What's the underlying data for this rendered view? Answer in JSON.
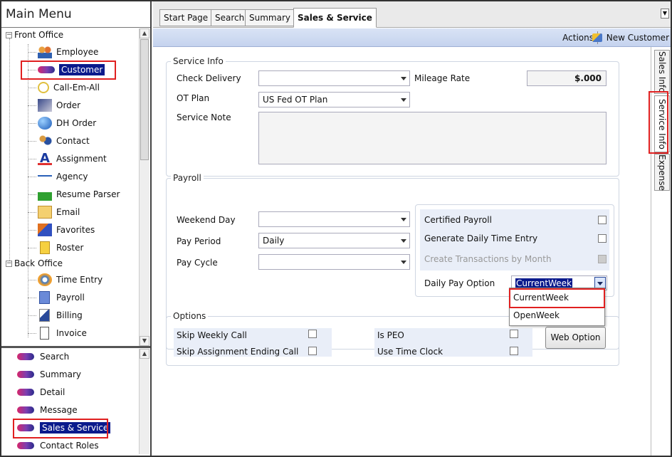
{
  "left_panel": {
    "title": "Main Menu",
    "front_office": {
      "label": "Front Office",
      "items": [
        "Employee",
        "Customer",
        "Call-Em-All",
        "Order",
        "DH Order",
        "Contact",
        "Assignment",
        "Agency",
        "Resume Parser",
        "Email",
        "Favorites",
        "Roster"
      ]
    },
    "back_office": {
      "label": "Back Office",
      "items": [
        "Time Entry",
        "Payroll",
        "Billing",
        "Invoice"
      ]
    },
    "bottom_items": [
      "Search",
      "Summary",
      "Detail",
      "Message",
      "Sales & Service",
      "Contact Roles"
    ]
  },
  "tabs": [
    "Start Page",
    "Search",
    "Summary",
    "Sales & Service"
  ],
  "toolbar": {
    "actions": "Actions",
    "new_customer": "New Customer"
  },
  "side_tabs": [
    "Sales Info",
    "Service Info",
    "Expense"
  ],
  "service_info": {
    "title": "Service Info",
    "check_delivery_label": "Check Delivery",
    "check_delivery_value": "",
    "mileage_rate_label": "Mileage Rate",
    "mileage_rate_value": "$.000",
    "ot_plan_label": "OT Plan",
    "ot_plan_value": "US Fed OT Plan",
    "service_note_label": "Service Note"
  },
  "payroll": {
    "title": "Payroll",
    "weekend_day_label": "Weekend Day",
    "weekend_day_value": "",
    "pay_period_label": "Pay Period",
    "pay_period_value": "Daily",
    "pay_cycle_label": "Pay Cycle",
    "pay_cycle_value": "",
    "certified_payroll_label": "Certified Payroll",
    "generate_daily_label": "Generate Daily Time Entry",
    "create_transactions_label": "Create Transactions by Month",
    "daily_pay_option_label": "Daily Pay Option",
    "daily_pay_option_value": "CurrentWeek",
    "daily_pay_options": [
      "CurrentWeek",
      "OpenWeek"
    ]
  },
  "options": {
    "title": "Options",
    "skip_weekly_call": "Skip Weekly Call",
    "skip_assignment_ending": "Skip Assignment Ending Call",
    "is_peo": "Is PEO",
    "use_time_clock": "Use Time Clock",
    "web_option": "Web Option"
  },
  "colors": {
    "highlight": "#e02020",
    "selection": "#0a1a8c",
    "toolbar": "#c5d3ee"
  }
}
